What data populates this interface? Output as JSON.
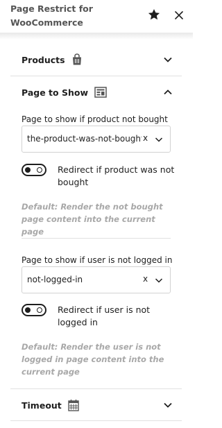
{
  "header": {
    "title": "Page Restrict for WooCommerce",
    "star_icon": "star-icon",
    "close_icon": "close-icon"
  },
  "panels": {
    "products": {
      "title": "Products",
      "icon": "shopping-bag-icon",
      "expanded": false
    },
    "page_to_show": {
      "title": "Page to Show",
      "icon": "page-layout-icon",
      "expanded": true
    },
    "timeout": {
      "title": "Timeout",
      "icon": "calendar-icon",
      "expanded": false
    }
  },
  "not_bought": {
    "label": "Page to show if product not bought",
    "select_value": "the-product-was-not-bought",
    "clear_label": "x",
    "toggle_label": "Redirect if product was not bought",
    "toggle_on": false,
    "help": "Default: Render the not bought page content into the current page"
  },
  "not_logged_in": {
    "label": "Page to show if user is not logged in",
    "select_value": "not-logged-in",
    "clear_label": "x",
    "toggle_label": "Redirect if user is not logged in",
    "toggle_on": false,
    "help": "Default: Render the user is not logged in page content into the current page"
  },
  "colors": {
    "text": "#1e1e1e",
    "muted": "#a8a8a8",
    "border": "#d2d2d2",
    "divider": "#e0e0e0"
  }
}
